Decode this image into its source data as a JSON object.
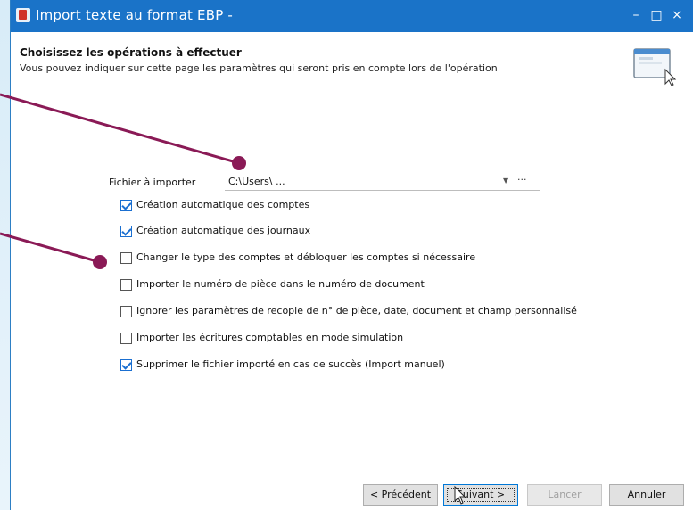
{
  "window": {
    "title": "Import texte au format EBP -",
    "controls": {
      "minimize": "–",
      "maximize": "□",
      "close": "×"
    }
  },
  "header": {
    "heading": "Choisissez les opérations à effectuer",
    "subheading": "Vous pouvez indiquer sur cette page les paramètres qui seront pris en compte lors de l'opération"
  },
  "form": {
    "file_label": "Fichier à importer",
    "file_value": "C:\\Users\\ ...",
    "file_browse": "···",
    "options": [
      {
        "label": "Création automatique des comptes",
        "checked": true
      },
      {
        "label": "Création automatique des journaux",
        "checked": true
      },
      {
        "label": "Changer le type des comptes et débloquer les comptes si nécessaire",
        "checked": false
      },
      {
        "label": "Importer le numéro de pièce dans le numéro de document",
        "checked": false
      },
      {
        "label": "Ignorer les paramètres de recopie de n° de pièce, date, document et champ personnalisé",
        "checked": false
      },
      {
        "label": "Importer les écritures comptables en mode simulation",
        "checked": false
      },
      {
        "label": "Supprimer le fichier importé en cas de succès (Import manuel)",
        "checked": true
      }
    ]
  },
  "footer": {
    "previous": "< Précédent",
    "next": "Suivant >",
    "launch": "Lancer",
    "cancel": "Annuler"
  },
  "colors": {
    "titlebar": "#1a73c8",
    "accent": "#1a6fd1",
    "annotation": "#8a1a56"
  },
  "icons": [
    "app-icon",
    "window-graphic-icon",
    "chevron-down-icon",
    "mouse-cursor-icon"
  ]
}
